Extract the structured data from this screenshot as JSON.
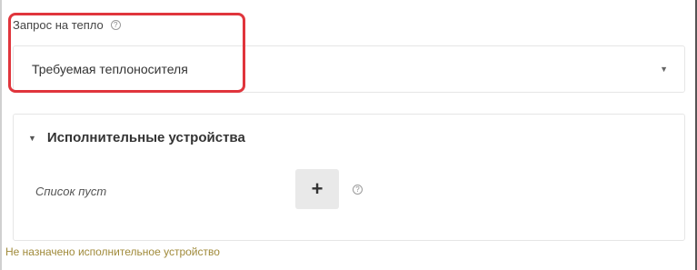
{
  "heat_request": {
    "label": "Запрос на тепло",
    "help": "?",
    "selected": "Требуемая теплоносителя",
    "caret": "▼"
  },
  "actuators": {
    "title": "Исполнительные устройства",
    "arrow": "▼",
    "empty_text": "Список пуст",
    "add_label": "+",
    "help": "?"
  },
  "warning": "Не назначено исполнительное устройство",
  "colors": {
    "highlight": "#e0353c",
    "warning_text": "#a08a3a"
  }
}
